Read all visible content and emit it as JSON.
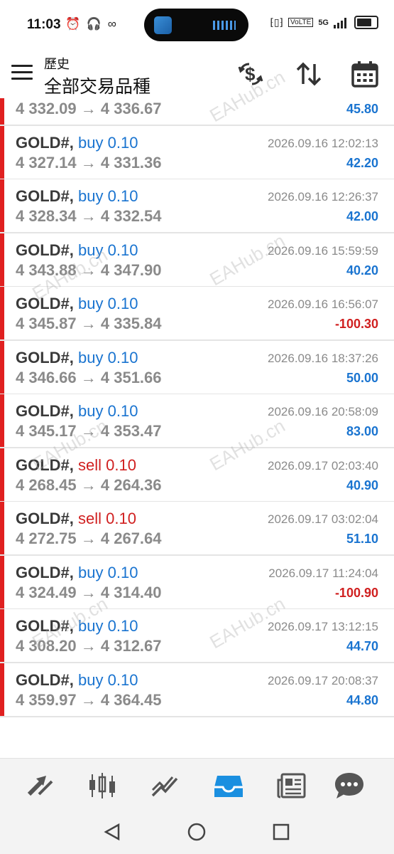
{
  "status_bar": {
    "time": "11:03",
    "left_icons": "⏰ 🎧 ∞",
    "network_labels": [
      "VoLTE",
      "HD",
      "5G"
    ]
  },
  "header": {
    "subtitle": "歷史",
    "title": "全部交易品種",
    "icons": [
      "currency-exchange-icon",
      "sort-icon",
      "calendar-icon"
    ]
  },
  "watermark": "EAHub.cn",
  "trades": [
    {
      "symbol": "GOLD#,",
      "type": "buy",
      "volume": "0.10",
      "open": "4 332.09",
      "close": "4 336.67",
      "date": "",
      "profit": "45.80",
      "sign": "pos",
      "partial": true
    },
    {
      "symbol": "GOLD#,",
      "type": "buy",
      "volume": "0.10",
      "open": "4 327.14",
      "close": "4 331.36",
      "date": "2026.09.16 12:02:13",
      "profit": "42.20",
      "sign": "pos"
    },
    {
      "symbol": "GOLD#,",
      "type": "buy",
      "volume": "0.10",
      "open": "4 328.34",
      "close": "4 332.54",
      "date": "2026.09.16 12:26:37",
      "profit": "42.00",
      "sign": "pos"
    },
    {
      "symbol": "GOLD#,",
      "type": "buy",
      "volume": "0.10",
      "open": "4 343.88",
      "close": "4 347.90",
      "date": "2026.09.16 15:59:59",
      "profit": "40.20",
      "sign": "pos"
    },
    {
      "symbol": "GOLD#,",
      "type": "buy",
      "volume": "0.10",
      "open": "4 345.87",
      "close": "4 335.84",
      "date": "2026.09.16 16:56:07",
      "profit": "-100.30",
      "sign": "neg"
    },
    {
      "symbol": "GOLD#,",
      "type": "buy",
      "volume": "0.10",
      "open": "4 346.66",
      "close": "4 351.66",
      "date": "2026.09.16 18:37:26",
      "profit": "50.00",
      "sign": "pos"
    },
    {
      "symbol": "GOLD#,",
      "type": "buy",
      "volume": "0.10",
      "open": "4 345.17",
      "close": "4 353.47",
      "date": "2026.09.16 20:58:09",
      "profit": "83.00",
      "sign": "pos"
    },
    {
      "symbol": "GOLD#,",
      "type": "sell",
      "volume": "0.10",
      "open": "4 268.45",
      "close": "4 264.36",
      "date": "2026.09.17 02:03:40",
      "profit": "40.90",
      "sign": "pos"
    },
    {
      "symbol": "GOLD#,",
      "type": "sell",
      "volume": "0.10",
      "open": "4 272.75",
      "close": "4 267.64",
      "date": "2026.09.17 03:02:04",
      "profit": "51.10",
      "sign": "pos"
    },
    {
      "symbol": "GOLD#,",
      "type": "buy",
      "volume": "0.10",
      "open": "4 324.49",
      "close": "4 314.40",
      "date": "2026.09.17 11:24:04",
      "profit": "-100.90",
      "sign": "neg"
    },
    {
      "symbol": "GOLD#,",
      "type": "buy",
      "volume": "0.10",
      "open": "4 308.20",
      "close": "4 312.67",
      "date": "2026.09.17 13:12:15",
      "profit": "44.70",
      "sign": "pos"
    },
    {
      "symbol": "GOLD#,",
      "type": "buy",
      "volume": "0.10",
      "open": "4 359.97",
      "close": "4 364.45",
      "date": "2026.09.17 20:08:37",
      "profit": "44.80",
      "sign": "pos"
    }
  ],
  "bottom_nav": {
    "items": [
      "quotes-icon",
      "chart-icon",
      "trade-icon",
      "history-icon",
      "news-icon",
      "chat-icon"
    ],
    "active": "history-icon"
  },
  "colors": {
    "buy": "#1a74d0",
    "sell": "#d02020",
    "profit_positive": "#1a74d0",
    "profit_negative": "#d02020",
    "row_bar": "#e02020",
    "active_nav": "#1a8fe0"
  }
}
